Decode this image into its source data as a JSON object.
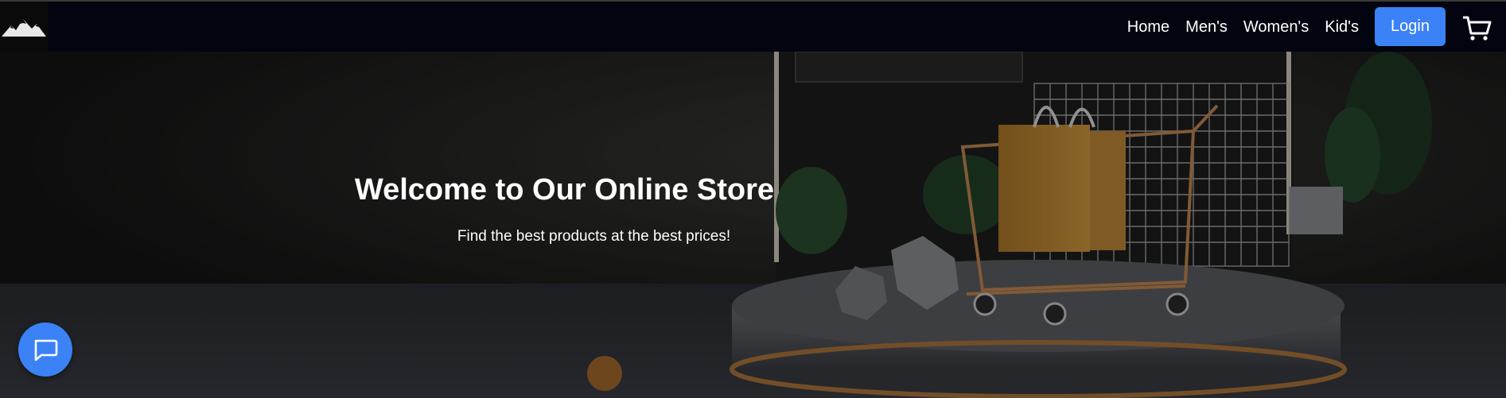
{
  "nav": {
    "links": [
      "Home",
      "Men's",
      "Women's",
      "Kid's"
    ],
    "login_label": "Login"
  },
  "hero": {
    "title": "Welcome to Our Online Store",
    "subtitle": "Find the best products at the best prices!"
  },
  "icons": {
    "logo": "mountain-logo",
    "cart": "cart-icon",
    "chat": "chat-bubble-icon"
  },
  "colors": {
    "navbar_bg": "#02050f",
    "accent": "#3b82f6",
    "text": "#ffffff"
  }
}
